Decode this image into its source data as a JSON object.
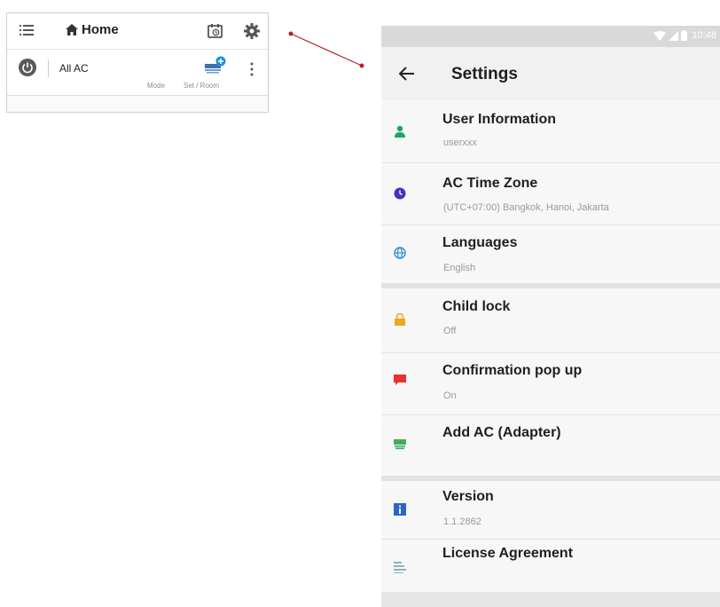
{
  "home": {
    "title": "Home",
    "ac_name": "All AC",
    "mode_label": "Mode",
    "set_room_label": "Set / Room",
    "icons": {
      "menu": "menu-list-icon",
      "home": "house-icon",
      "schedule": "calendar-clock-icon",
      "settings": "gear-icon",
      "power": "power-icon",
      "add_ac": "ac-add-icon",
      "more": "more-vertical-icon"
    }
  },
  "status_bar": {
    "time": "10:48",
    "icons": [
      "wifi-icon",
      "cell-signal-icon",
      "battery-icon"
    ]
  },
  "settings": {
    "title": "Settings",
    "back_icon": "arrow-left-icon",
    "sections": [
      [
        {
          "title": "User Information",
          "subtitle": "userxxx",
          "icon": "user-icon",
          "icon_color": "#1aa760"
        },
        {
          "title": "AC Time Zone",
          "subtitle": "(UTC+07:00) Bangkok, Hanoi, Jakarta",
          "icon": "clock-icon",
          "icon_color": "#4a2fbf"
        },
        {
          "title": "Languages",
          "subtitle": "English",
          "icon": "globe-icon",
          "icon_color": "#2f8fd6"
        }
      ],
      [
        {
          "title": "Child lock",
          "subtitle": "Off",
          "icon": "lock-icon",
          "icon_color": "#f2a51d"
        },
        {
          "title": "Confirmation pop up",
          "subtitle": "On",
          "icon": "chat-bubble-icon",
          "icon_color": "#e83232"
        },
        {
          "title": "Add AC (Adapter)",
          "subtitle": "",
          "icon": "ac-unit-icon",
          "icon_color": "#3fae5a"
        }
      ],
      [
        {
          "title": "Version",
          "subtitle": "1.1.2862",
          "icon": "info-icon",
          "icon_color": "#2f63c9"
        },
        {
          "title": "License Agreement",
          "subtitle": "",
          "icon": "document-lines-icon",
          "icon_color": "#8fb0c8"
        }
      ]
    ]
  },
  "colors": {
    "accent_red_connector": "#b0252a",
    "status_bar_bg": "#d9d9d9",
    "app_bar_bg": "#f1f1f1"
  }
}
